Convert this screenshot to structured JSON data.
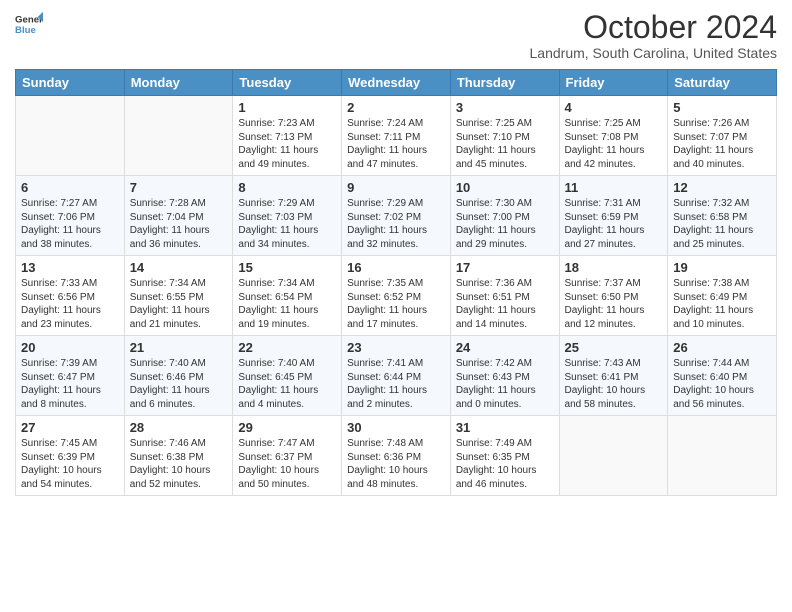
{
  "header": {
    "logo_line1": "General",
    "logo_line2": "Blue",
    "month": "October 2024",
    "location": "Landrum, South Carolina, United States"
  },
  "weekdays": [
    "Sunday",
    "Monday",
    "Tuesday",
    "Wednesday",
    "Thursday",
    "Friday",
    "Saturday"
  ],
  "weeks": [
    [
      {
        "day": "",
        "sunrise": "",
        "sunset": "",
        "daylight": ""
      },
      {
        "day": "",
        "sunrise": "",
        "sunset": "",
        "daylight": ""
      },
      {
        "day": "1",
        "sunrise": "Sunrise: 7:23 AM",
        "sunset": "Sunset: 7:13 PM",
        "daylight": "Daylight: 11 hours and 49 minutes."
      },
      {
        "day": "2",
        "sunrise": "Sunrise: 7:24 AM",
        "sunset": "Sunset: 7:11 PM",
        "daylight": "Daylight: 11 hours and 47 minutes."
      },
      {
        "day": "3",
        "sunrise": "Sunrise: 7:25 AM",
        "sunset": "Sunset: 7:10 PM",
        "daylight": "Daylight: 11 hours and 45 minutes."
      },
      {
        "day": "4",
        "sunrise": "Sunrise: 7:25 AM",
        "sunset": "Sunset: 7:08 PM",
        "daylight": "Daylight: 11 hours and 42 minutes."
      },
      {
        "day": "5",
        "sunrise": "Sunrise: 7:26 AM",
        "sunset": "Sunset: 7:07 PM",
        "daylight": "Daylight: 11 hours and 40 minutes."
      }
    ],
    [
      {
        "day": "6",
        "sunrise": "Sunrise: 7:27 AM",
        "sunset": "Sunset: 7:06 PM",
        "daylight": "Daylight: 11 hours and 38 minutes."
      },
      {
        "day": "7",
        "sunrise": "Sunrise: 7:28 AM",
        "sunset": "Sunset: 7:04 PM",
        "daylight": "Daylight: 11 hours and 36 minutes."
      },
      {
        "day": "8",
        "sunrise": "Sunrise: 7:29 AM",
        "sunset": "Sunset: 7:03 PM",
        "daylight": "Daylight: 11 hours and 34 minutes."
      },
      {
        "day": "9",
        "sunrise": "Sunrise: 7:29 AM",
        "sunset": "Sunset: 7:02 PM",
        "daylight": "Daylight: 11 hours and 32 minutes."
      },
      {
        "day": "10",
        "sunrise": "Sunrise: 7:30 AM",
        "sunset": "Sunset: 7:00 PM",
        "daylight": "Daylight: 11 hours and 29 minutes."
      },
      {
        "day": "11",
        "sunrise": "Sunrise: 7:31 AM",
        "sunset": "Sunset: 6:59 PM",
        "daylight": "Daylight: 11 hours and 27 minutes."
      },
      {
        "day": "12",
        "sunrise": "Sunrise: 7:32 AM",
        "sunset": "Sunset: 6:58 PM",
        "daylight": "Daylight: 11 hours and 25 minutes."
      }
    ],
    [
      {
        "day": "13",
        "sunrise": "Sunrise: 7:33 AM",
        "sunset": "Sunset: 6:56 PM",
        "daylight": "Daylight: 11 hours and 23 minutes."
      },
      {
        "day": "14",
        "sunrise": "Sunrise: 7:34 AM",
        "sunset": "Sunset: 6:55 PM",
        "daylight": "Daylight: 11 hours and 21 minutes."
      },
      {
        "day": "15",
        "sunrise": "Sunrise: 7:34 AM",
        "sunset": "Sunset: 6:54 PM",
        "daylight": "Daylight: 11 hours and 19 minutes."
      },
      {
        "day": "16",
        "sunrise": "Sunrise: 7:35 AM",
        "sunset": "Sunset: 6:52 PM",
        "daylight": "Daylight: 11 hours and 17 minutes."
      },
      {
        "day": "17",
        "sunrise": "Sunrise: 7:36 AM",
        "sunset": "Sunset: 6:51 PM",
        "daylight": "Daylight: 11 hours and 14 minutes."
      },
      {
        "day": "18",
        "sunrise": "Sunrise: 7:37 AM",
        "sunset": "Sunset: 6:50 PM",
        "daylight": "Daylight: 11 hours and 12 minutes."
      },
      {
        "day": "19",
        "sunrise": "Sunrise: 7:38 AM",
        "sunset": "Sunset: 6:49 PM",
        "daylight": "Daylight: 11 hours and 10 minutes."
      }
    ],
    [
      {
        "day": "20",
        "sunrise": "Sunrise: 7:39 AM",
        "sunset": "Sunset: 6:47 PM",
        "daylight": "Daylight: 11 hours and 8 minutes."
      },
      {
        "day": "21",
        "sunrise": "Sunrise: 7:40 AM",
        "sunset": "Sunset: 6:46 PM",
        "daylight": "Daylight: 11 hours and 6 minutes."
      },
      {
        "day": "22",
        "sunrise": "Sunrise: 7:40 AM",
        "sunset": "Sunset: 6:45 PM",
        "daylight": "Daylight: 11 hours and 4 minutes."
      },
      {
        "day": "23",
        "sunrise": "Sunrise: 7:41 AM",
        "sunset": "Sunset: 6:44 PM",
        "daylight": "Daylight: 11 hours and 2 minutes."
      },
      {
        "day": "24",
        "sunrise": "Sunrise: 7:42 AM",
        "sunset": "Sunset: 6:43 PM",
        "daylight": "Daylight: 11 hours and 0 minutes."
      },
      {
        "day": "25",
        "sunrise": "Sunrise: 7:43 AM",
        "sunset": "Sunset: 6:41 PM",
        "daylight": "Daylight: 10 hours and 58 minutes."
      },
      {
        "day": "26",
        "sunrise": "Sunrise: 7:44 AM",
        "sunset": "Sunset: 6:40 PM",
        "daylight": "Daylight: 10 hours and 56 minutes."
      }
    ],
    [
      {
        "day": "27",
        "sunrise": "Sunrise: 7:45 AM",
        "sunset": "Sunset: 6:39 PM",
        "daylight": "Daylight: 10 hours and 54 minutes."
      },
      {
        "day": "28",
        "sunrise": "Sunrise: 7:46 AM",
        "sunset": "Sunset: 6:38 PM",
        "daylight": "Daylight: 10 hours and 52 minutes."
      },
      {
        "day": "29",
        "sunrise": "Sunrise: 7:47 AM",
        "sunset": "Sunset: 6:37 PM",
        "daylight": "Daylight: 10 hours and 50 minutes."
      },
      {
        "day": "30",
        "sunrise": "Sunrise: 7:48 AM",
        "sunset": "Sunset: 6:36 PM",
        "daylight": "Daylight: 10 hours and 48 minutes."
      },
      {
        "day": "31",
        "sunrise": "Sunrise: 7:49 AM",
        "sunset": "Sunset: 6:35 PM",
        "daylight": "Daylight: 10 hours and 46 minutes."
      },
      {
        "day": "",
        "sunrise": "",
        "sunset": "",
        "daylight": ""
      },
      {
        "day": "",
        "sunrise": "",
        "sunset": "",
        "daylight": ""
      }
    ]
  ]
}
